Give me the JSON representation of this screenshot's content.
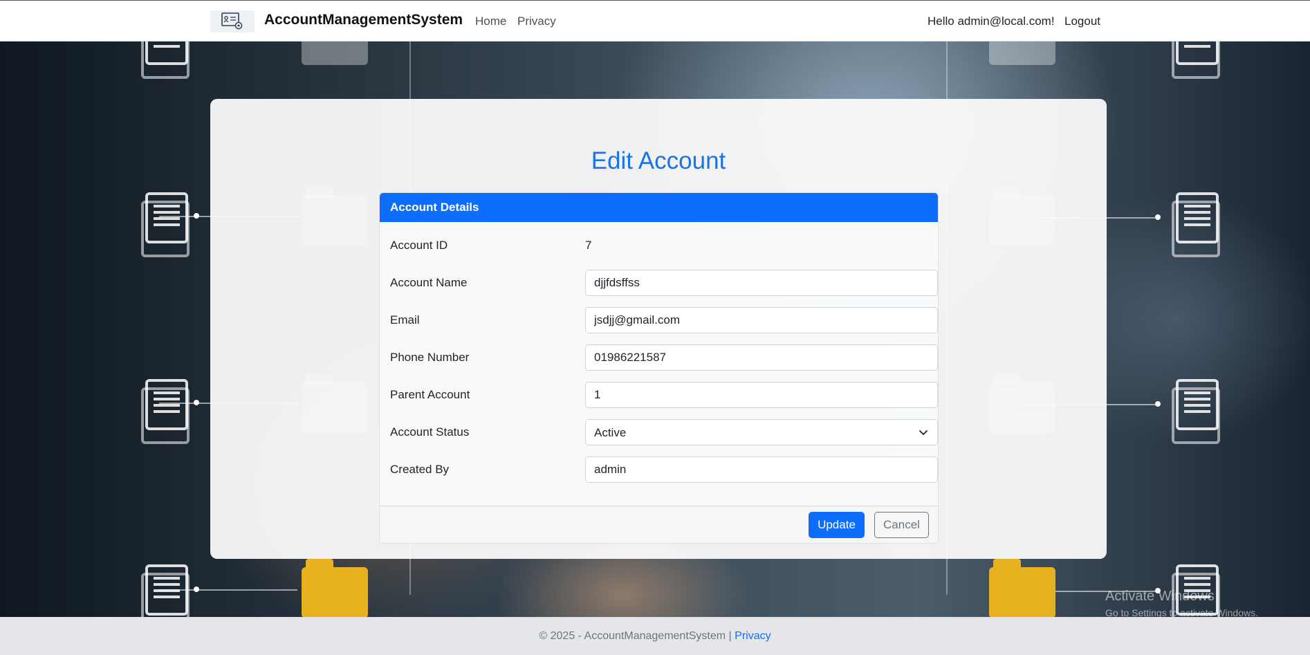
{
  "navbar": {
    "brand": "AccountManagementSystem",
    "links": [
      "Home",
      "Privacy"
    ],
    "greeting": "Hello admin@local.com!",
    "logout": "Logout"
  },
  "page": {
    "title": "Edit Account"
  },
  "card": {
    "header": "Account Details",
    "fields": {
      "account_id": {
        "label": "Account ID",
        "value": "7"
      },
      "account_name": {
        "label": "Account Name",
        "value": "djjfdsffss"
      },
      "email": {
        "label": "Email",
        "value": "jsdjj@gmail.com"
      },
      "phone": {
        "label": "Phone Number",
        "value": "01986221587"
      },
      "parent": {
        "label": "Parent Account",
        "value": "1"
      },
      "status": {
        "label": "Account Status",
        "value": "Active"
      },
      "created_by": {
        "label": "Created By",
        "value": "admin"
      }
    },
    "buttons": {
      "update": "Update",
      "cancel": "Cancel"
    }
  },
  "footer": {
    "text": "© 2025 - AccountManagementSystem |",
    "link": "Privacy"
  },
  "watermark": {
    "title": "Activate Windows",
    "subtitle": "Go to Settings to activate Windows."
  },
  "colors": {
    "primary": "#0d6efd",
    "title": "#1a73e8"
  },
  "icons": {
    "brand": "account-management-logo-icon",
    "select": "chevron-down-icon"
  }
}
